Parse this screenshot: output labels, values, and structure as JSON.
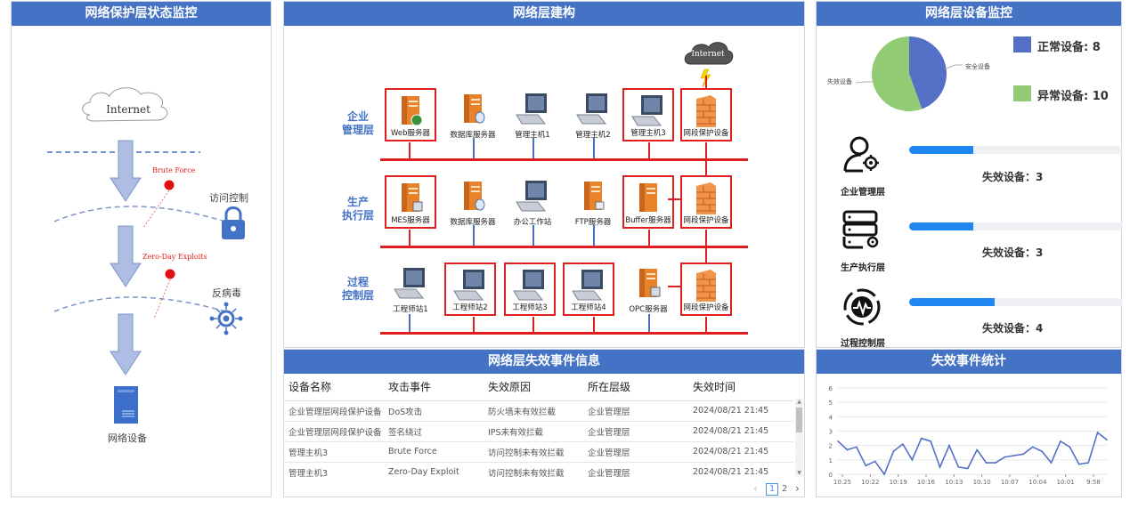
{
  "left_panel": {
    "title": "网络保护层状态监控",
    "internet": "Internet",
    "brute_force": "Brute Force",
    "zero_day": "Zero-Day Exploits",
    "access_control": "访问控制",
    "antivirus": "反病毒",
    "network_device": "网络设备"
  },
  "center_panel": {
    "title": "网络层建构",
    "internet_cloud": "Internet",
    "zones": [
      {
        "label": "企业\n管理层",
        "devices": [
          "Web服务器",
          "数据库服务器",
          "管理主机1",
          "管理主机2",
          "管理主机3",
          "网段保护设备"
        ]
      },
      {
        "label": "生产\n执行层",
        "devices": [
          "MES服务器",
          "数据库服务器",
          "办公工作站",
          "FTP服务器",
          "Buffer服务器",
          "网段保护设备"
        ]
      },
      {
        "label": "过程\n控制层",
        "devices": [
          "工程师站1",
          "工程师站2",
          "工程师站3",
          "工程师站4",
          "OPC服务器",
          "网段保护设备"
        ]
      }
    ]
  },
  "events_panel": {
    "title": "网络层失效事件信息",
    "columns": [
      "设备名称",
      "攻击事件",
      "失效原因",
      "所在层级",
      "失效时间"
    ],
    "rows": [
      [
        "企业管理层网段保护设备",
        "DoS攻击",
        "防火墙未有效拦截",
        "企业管理层",
        "2024/08/21 21:45"
      ],
      [
        "企业管理层网段保护设备",
        "签名绕过",
        "IPS未有效拦截",
        "企业管理层",
        "2024/08/21 21:45"
      ],
      [
        "管理主机3",
        "Brute Force",
        "访问控制未有效拦截",
        "企业管理层",
        "2024/08/21 21:45"
      ],
      [
        "管理主机3",
        "Zero-Day Exploit",
        "访问控制未有效拦截",
        "企业管理层",
        "2024/08/21 21:45"
      ]
    ],
    "pager": {
      "prev": "‹",
      "page1": "1",
      "page2": "2",
      "next": "›"
    }
  },
  "device_panel": {
    "title": "网络层设备监控",
    "pie": {
      "safe_label": "安全设备",
      "fail_label": "失效设备",
      "safe_value": 8,
      "fail_value": 10
    },
    "legend_normal": "正常设备: 8",
    "legend_abnormal": "异常设备: 10",
    "colors": {
      "normal": "#5470c6",
      "abnormal": "#91cc75",
      "bar": "#1e88f0"
    },
    "layers": [
      {
        "name": "企业管理层",
        "status": "失效设备：3",
        "fraction": 0.3
      },
      {
        "name": "生产执行层",
        "status": "失效设备：3",
        "fraction": 0.3
      },
      {
        "name": "过程控制层",
        "status": "失效设备：4",
        "fraction": 0.4
      }
    ]
  },
  "stats_panel": {
    "title": "失效事件统计",
    "chart_data": {
      "type": "line",
      "x": [
        "10:25",
        "10:22",
        "10:19",
        "10:16",
        "10:13",
        "10:10",
        "10:07",
        "10:04",
        "10:01",
        "9:58"
      ],
      "yticks": [
        0,
        1,
        2,
        3,
        4,
        5,
        6
      ],
      "ylim": [
        0,
        6
      ],
      "values": [
        2.3,
        1.7,
        1.9,
        0.6,
        0.9,
        0.0,
        1.6,
        2.1,
        1.0,
        2.5,
        2.3,
        0.5,
        2.0,
        0.5,
        0.4,
        1.7,
        0.8,
        0.8,
        1.2,
        1.3,
        1.4,
        1.9,
        1.6,
        0.8,
        2.3,
        1.9,
        0.7,
        0.8,
        2.9,
        2.4
      ]
    }
  }
}
